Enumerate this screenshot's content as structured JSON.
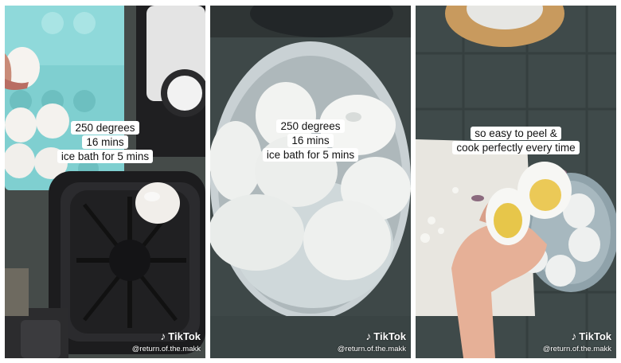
{
  "panels": [
    {
      "id": "airfryer",
      "caption": [
        "250 degrees",
        "16 mins",
        "ice bath for 5 mins"
      ],
      "watermark": {
        "brand": "TikTok",
        "handle": "@return.of.the.makk",
        "icon": "tiktok-note-icon"
      }
    },
    {
      "id": "egg-bowl",
      "caption": [
        "250 degrees",
        "16 mins",
        "ice bath for 5 mins"
      ],
      "watermark": {
        "brand": "TikTok",
        "handle": "@return.of.the.makk",
        "icon": "tiktok-note-icon"
      }
    },
    {
      "id": "peeled-egg",
      "caption": [
        "so easy to peel &",
        "cook perfectly every time"
      ],
      "watermark": {
        "brand": "TikTok",
        "handle": "@return.of.the.makk",
        "icon": "tiktok-note-icon"
      }
    }
  ],
  "colors": {
    "carton": "#7fcfd0",
    "fryer": "#1c1c1e",
    "bowl": "#c4cdd0",
    "yolk": "#e8c84a",
    "tile": "#3f4a4a"
  }
}
